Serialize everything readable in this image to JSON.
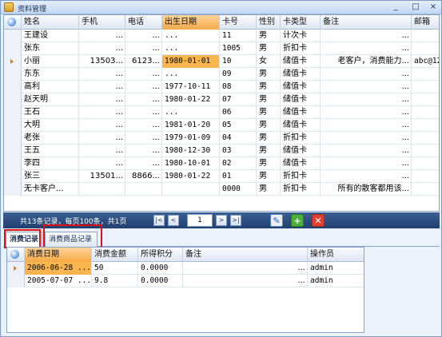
{
  "window": {
    "title": "资料管理",
    "minimize": "_",
    "maximize": "□",
    "close": "×"
  },
  "grid": {
    "columns": [
      "姓名",
      "手机",
      "电话",
      "出生日期",
      "卡号",
      "性别",
      "卡类型",
      "备注",
      "邮箱"
    ],
    "rows": [
      {
        "name": "王建设",
        "mobile": "...",
        "phone": "...",
        "birth": "...",
        "card": "11",
        "gender": "男",
        "type": "计次卡",
        "note": "...",
        "email": ""
      },
      {
        "name": "张东",
        "mobile": "...",
        "phone": "...",
        "birth": "...",
        "card": "1005",
        "gender": "男",
        "type": "折扣卡",
        "note": "...",
        "email": ""
      },
      {
        "name": "小丽",
        "mobile": "13503...",
        "phone": "6123...",
        "birth": "1980-01-01",
        "card": "10",
        "gender": "女",
        "type": "储值卡",
        "note": "老客户，消费能力...",
        "email": "abc@12"
      },
      {
        "name": "东东",
        "mobile": "...",
        "phone": "...",
        "birth": "...",
        "card": "09",
        "gender": "男",
        "type": "储值卡",
        "note": "...",
        "email": ""
      },
      {
        "name": "高利",
        "mobile": "...",
        "phone": "...",
        "birth": "1977-10-11",
        "card": "08",
        "gender": "男",
        "type": "储值卡",
        "note": "...",
        "email": ""
      },
      {
        "name": "赵天明",
        "mobile": "...",
        "phone": "...",
        "birth": "1980-01-22",
        "card": "07",
        "gender": "男",
        "type": "储值卡",
        "note": "...",
        "email": ""
      },
      {
        "name": "王石",
        "mobile": "...",
        "phone": "...",
        "birth": "...",
        "card": "06",
        "gender": "男",
        "type": "储值卡",
        "note": "...",
        "email": ""
      },
      {
        "name": "大明",
        "mobile": "...",
        "phone": "...",
        "birth": "1981-01-20",
        "card": "05",
        "gender": "男",
        "type": "储值卡",
        "note": "...",
        "email": ""
      },
      {
        "name": "老张",
        "mobile": "...",
        "phone": "...",
        "birth": "1979-01-09",
        "card": "04",
        "gender": "男",
        "type": "折扣卡",
        "note": "...",
        "email": ""
      },
      {
        "name": "王五",
        "mobile": "...",
        "phone": "...",
        "birth": "1980-12-30",
        "card": "03",
        "gender": "男",
        "type": "储值卡",
        "note": "...",
        "email": ""
      },
      {
        "name": "李四",
        "mobile": "...",
        "phone": "...",
        "birth": "1980-10-01",
        "card": "02",
        "gender": "男",
        "type": "储值卡",
        "note": "...",
        "email": ""
      },
      {
        "name": "张三",
        "mobile": "13501...",
        "phone": "8866...",
        "birth": "1980-01-22",
        "card": "01",
        "gender": "男",
        "type": "折扣卡",
        "note": "...",
        "email": ""
      },
      {
        "name": "无卡客户...",
        "mobile": "",
        "phone": "",
        "birth": "",
        "card": "0000",
        "gender": "男",
        "type": "折扣卡",
        "note": "所有的散客都用该...",
        "email": ""
      }
    ]
  },
  "navigator": {
    "info": "共13条记录，每页100条，共1页",
    "first": "|<",
    "prev": "<",
    "page": "1",
    "next": ">",
    "last": ">|"
  },
  "tabs": {
    "consume_records": "消费记录",
    "consume_goods": "消费商品记录"
  },
  "subgrid": {
    "columns": [
      "消费日期",
      "消费金额",
      "所得积分",
      "备注",
      "操作员"
    ],
    "rows": [
      {
        "date": "2006-06-28 ...",
        "amount": "50",
        "points": "0.0000",
        "note": "...",
        "operator": "admin"
      },
      {
        "date": "2005-07-07 ...",
        "amount": "9.8",
        "points": "0.0000",
        "note": "...",
        "operator": "admin"
      }
    ]
  },
  "colors": {
    "selected_highlight": "#f9b64e",
    "navigator_bg": "#20406f",
    "annotation_red": "#e01010"
  }
}
